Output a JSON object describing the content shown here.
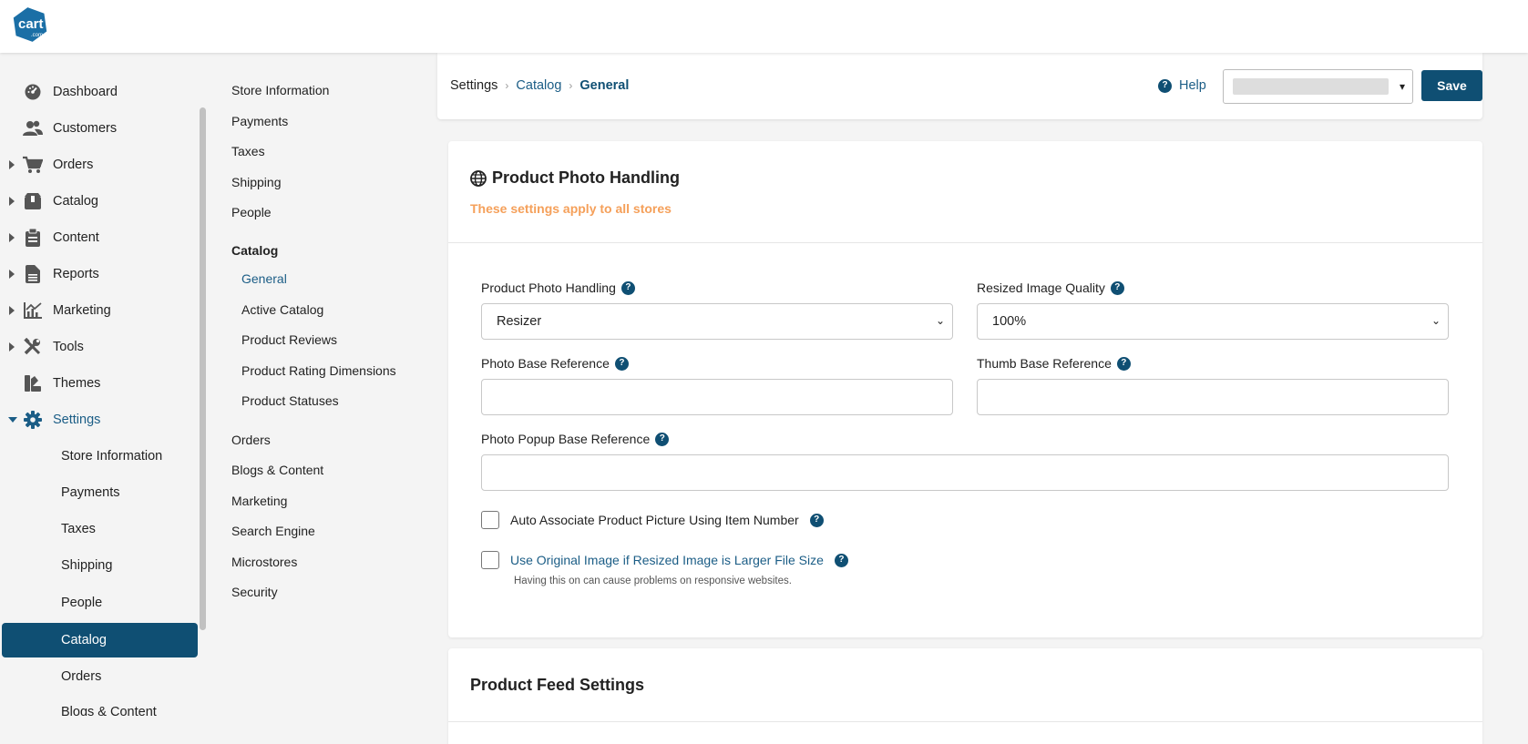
{
  "brand": {
    "logo_text": "cart",
    "logo_sub": ".com",
    "color": "#0f4f73"
  },
  "sidebar": {
    "items": [
      {
        "label": "Dashboard",
        "icon": "dashboard-icon",
        "expandable": false
      },
      {
        "label": "Customers",
        "icon": "customers-icon",
        "expandable": false
      },
      {
        "label": "Orders",
        "icon": "cart-icon",
        "expandable": true
      },
      {
        "label": "Catalog",
        "icon": "box-icon",
        "expandable": true
      },
      {
        "label": "Content",
        "icon": "clipboard-icon",
        "expandable": true
      },
      {
        "label": "Reports",
        "icon": "report-icon",
        "expandable": true
      },
      {
        "label": "Marketing",
        "icon": "chart-icon",
        "expandable": true
      },
      {
        "label": "Tools",
        "icon": "tools-icon",
        "expandable": true
      },
      {
        "label": "Themes",
        "icon": "themes-icon",
        "expandable": false
      },
      {
        "label": "Settings",
        "icon": "gear-icon",
        "expandable": true,
        "expanded": true
      }
    ],
    "settings_children": [
      "Store Information",
      "Payments",
      "Taxes",
      "Shipping",
      "People",
      "Catalog",
      "Orders",
      "Blogs & Content"
    ],
    "active_child": "Catalog"
  },
  "settings_nav": {
    "top": [
      "Store Information",
      "Payments",
      "Taxes",
      "Shipping",
      "People"
    ],
    "catalog_heading": "Catalog",
    "catalog_children": [
      "General",
      "Active Catalog",
      "Product Reviews",
      "Product Rating Dimensions",
      "Product Statuses"
    ],
    "current": "General",
    "bottom": [
      "Orders",
      "Blogs & Content",
      "Marketing",
      "Search Engine",
      "Microstores",
      "Security"
    ]
  },
  "header": {
    "breadcrumb": [
      "Settings",
      "Catalog",
      "General"
    ],
    "help_label": "Help",
    "save_label": "Save"
  },
  "photo_panel": {
    "title": "Product Photo Handling",
    "subtitle": "These settings apply to all stores",
    "fields": {
      "photo_handling": {
        "label": "Product Photo Handling",
        "value": "Resizer"
      },
      "image_quality": {
        "label": "Resized Image Quality",
        "value": "100%"
      },
      "photo_base": {
        "label": "Photo Base Reference",
        "value": ""
      },
      "thumb_base": {
        "label": "Thumb Base Reference",
        "value": ""
      },
      "popup_base": {
        "label": "Photo Popup Base Reference",
        "value": ""
      }
    },
    "checkboxes": [
      {
        "label": "Auto Associate Product Picture Using Item Number",
        "checked": false
      },
      {
        "label": "Use Original Image if Resized Image is Larger File Size",
        "checked": false,
        "note": "Having this on can cause problems on responsive websites."
      }
    ]
  },
  "feed_panel": {
    "title": "Product Feed Settings"
  },
  "colors": {
    "primary": "#0f4f73",
    "link": "#1b5d86",
    "warning_text": "#f5a05a"
  }
}
